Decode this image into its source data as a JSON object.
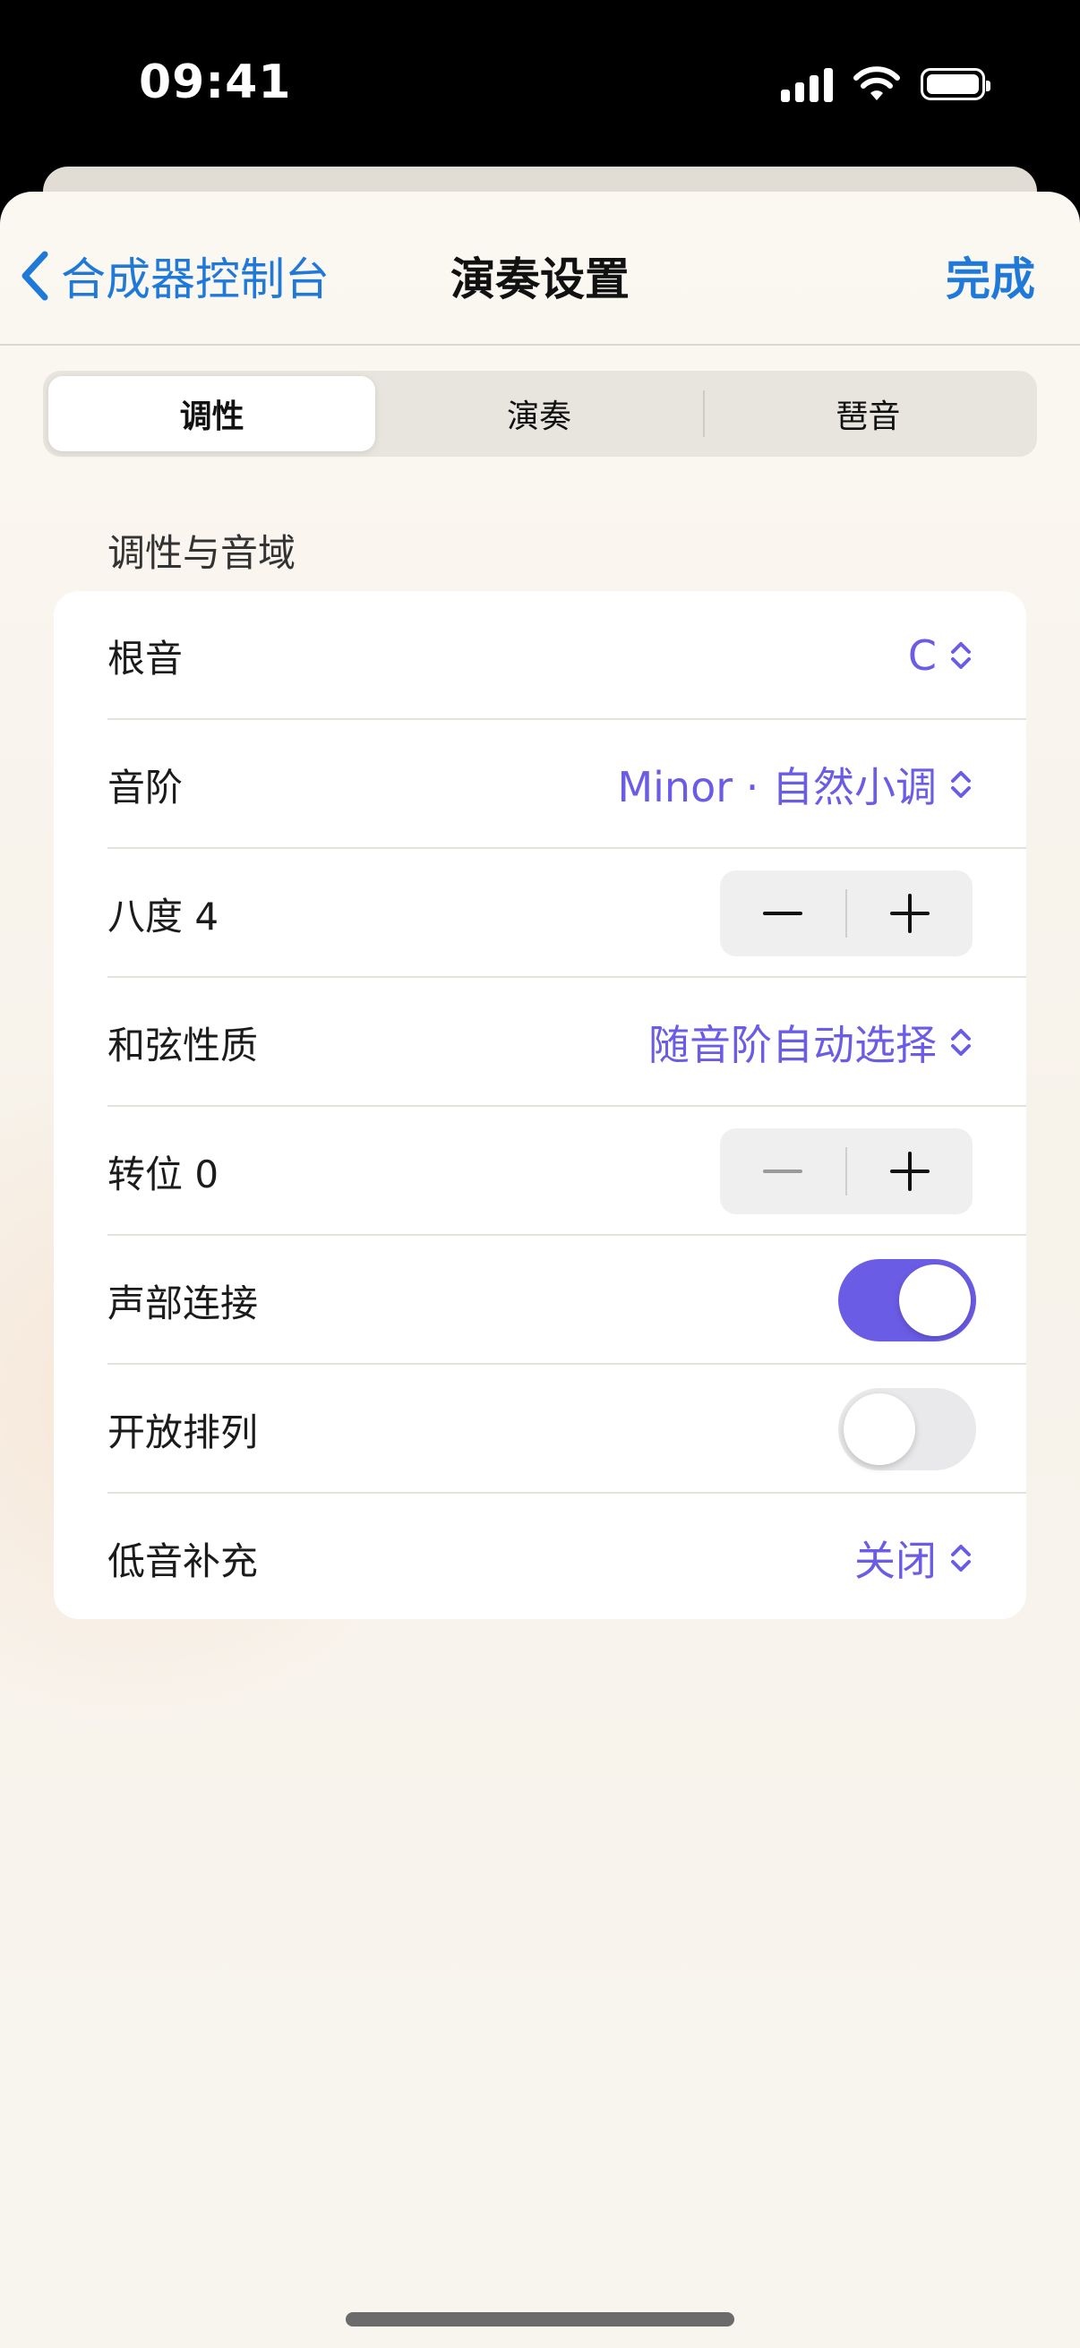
{
  "status": {
    "time": "09:41"
  },
  "nav": {
    "back_label": "合成器控制台",
    "title": "演奏设置",
    "done_label": "完成"
  },
  "segments": [
    {
      "label": "调性",
      "selected": true
    },
    {
      "label": "演奏",
      "selected": false
    },
    {
      "label": "琶音",
      "selected": false
    }
  ],
  "section": {
    "header": "调性与音域"
  },
  "rows": {
    "root": {
      "label": "根音",
      "value": "C"
    },
    "scale": {
      "label": "音阶",
      "value": "Minor · 自然小调"
    },
    "octave": {
      "label": "八度 4"
    },
    "chord_quality": {
      "label": "和弦性质",
      "value": "随音阶自动选择"
    },
    "transpose": {
      "label": "转位 0"
    },
    "voice_leading": {
      "label": "声部连接",
      "on": true
    },
    "open_voicing": {
      "label": "开放排列",
      "on": false
    },
    "bass_fill": {
      "label": "低音补充",
      "value": "关闭"
    }
  },
  "colors": {
    "accent": "#6b5ce6",
    "link": "#1f79d9"
  }
}
